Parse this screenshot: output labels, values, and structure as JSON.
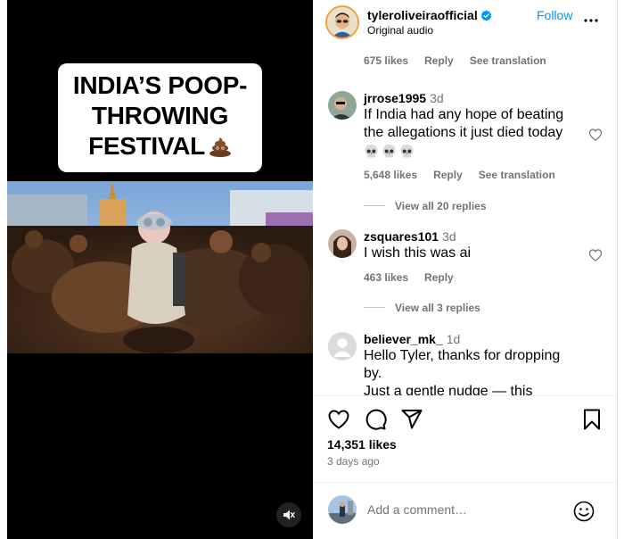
{
  "media": {
    "title_lines": [
      "INDIA’S POOP-",
      "THROWING",
      "FESTIVAL"
    ],
    "title_emoji": "pile-of-poo-emoji",
    "mute_icon": "speaker-muted-icon"
  },
  "header": {
    "username": "tyleroliveiraofficial",
    "verified": true,
    "subtitle": "Original audio",
    "follow_label": "Follow",
    "more_icon": "more-horizontal-icon"
  },
  "comments": {
    "top_meta": {
      "likes": "675 likes",
      "reply": "Reply",
      "translation": "See translation"
    },
    "items": [
      {
        "user": "jrrose1995",
        "age": "3d",
        "text_lines": [
          "If India had any hope of beating",
          "the allegations it just died today"
        ],
        "emoji": [
          "skull-emoji",
          "skull-emoji",
          "skull-emoji"
        ],
        "likes": "5,648 likes",
        "reply": "Reply",
        "translation": "See translation",
        "view_replies": "View all 20 replies"
      },
      {
        "user": "zsquares101",
        "age": "3d",
        "text_lines": [
          "I wish this was ai"
        ],
        "likes": "463 likes",
        "reply": "Reply",
        "view_replies": "View all 3 replies"
      },
      {
        "user": "believer_mk_",
        "age": "1d",
        "text_lines": [
          "Hello Tyler, thanks for dropping",
          "by.",
          "Just a gentle nudge — this"
        ]
      }
    ]
  },
  "actions": {
    "icons": [
      "heart-icon",
      "comment-icon",
      "share-icon",
      "bookmark-icon"
    ],
    "likes": "14,351 likes",
    "posted": "3 days ago"
  },
  "composer": {
    "placeholder": "Add a comment…",
    "emoji_icon": "smiley-icon"
  },
  "colors": {
    "accent": "#0095f6",
    "muted": "#737373",
    "divider": "#efefef"
  }
}
